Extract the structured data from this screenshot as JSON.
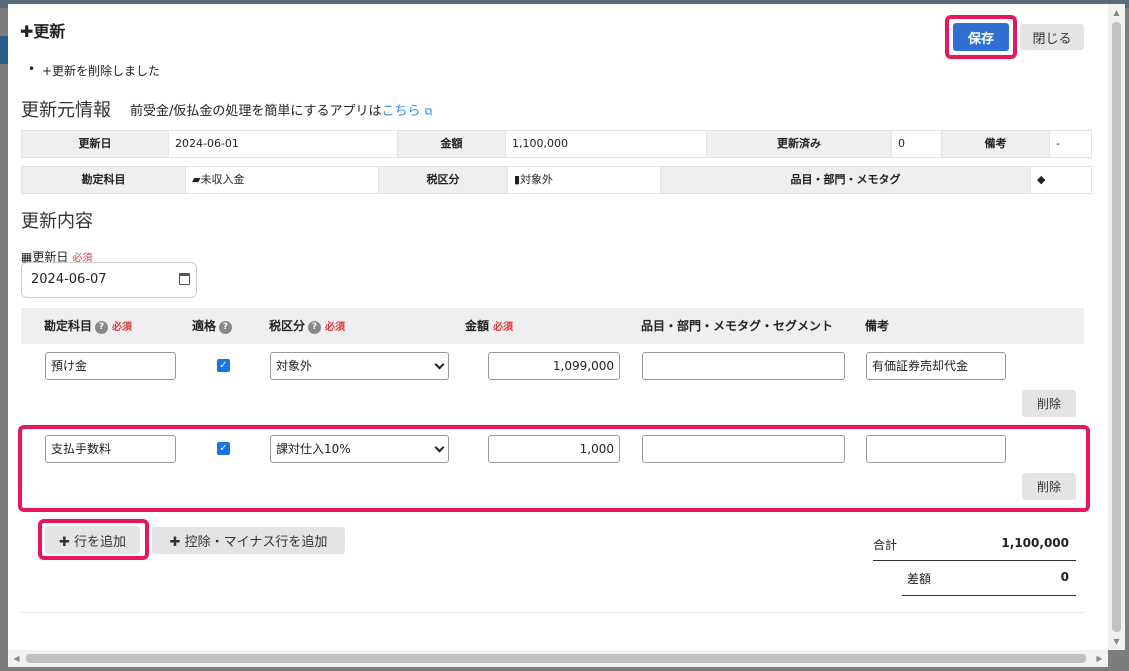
{
  "header": {
    "title": "✚更新",
    "save_label": "保存",
    "close_label": "閉じる"
  },
  "notice": "+更新を削除しました",
  "source_section": {
    "title": "更新元情報",
    "subtitle": "前受金/仮払金の処理を簡単にするアプリは",
    "link": "こちら",
    "row1": {
      "date_label": "更新日",
      "date_value": "2024-06-01",
      "amount_label": "金額",
      "amount_value": "1,100,000",
      "renewed_label": "更新済み",
      "renewed_value": "0",
      "note_label": "備考",
      "note_value": "-"
    },
    "row2": {
      "account_label": "勘定科目",
      "account_value": "未収入金",
      "tax_label": "税区分",
      "tax_value": "対象外",
      "item_label": "品目・部門・メモタグ",
      "item_value": ""
    }
  },
  "update_section": {
    "title": "更新内容",
    "date_label": "更新日",
    "required": "必須",
    "date_value": "2024-06-07"
  },
  "table": {
    "headers": {
      "account": "勘定科目",
      "qualified": "適格",
      "tax": "税区分",
      "amount": "金額",
      "tags": "品目・部門・メモタグ・セグメント",
      "note": "備考"
    },
    "rows": [
      {
        "account": "預け金",
        "qualified": true,
        "tax": "対象外",
        "amount": "1,099,000",
        "tags": "",
        "note": "有価証券売却代金"
      },
      {
        "account": "支払手数料",
        "qualified": true,
        "tax": "課対仕入10%",
        "amount": "1,000",
        "tags": "",
        "note": ""
      }
    ],
    "delete_label": "削除"
  },
  "actions": {
    "add_row": "✚ 行を追加",
    "add_deduction": "✚ 控除・マイナス行を追加"
  },
  "summary": {
    "total_label": "合計",
    "total_value": "1,100,000",
    "diff_label": "差額",
    "diff_value": "0"
  },
  "colors": {
    "highlight": "#e8175d",
    "primary": "#2f6fd1",
    "required": "#e0383e",
    "link": "#3a8ee6"
  }
}
